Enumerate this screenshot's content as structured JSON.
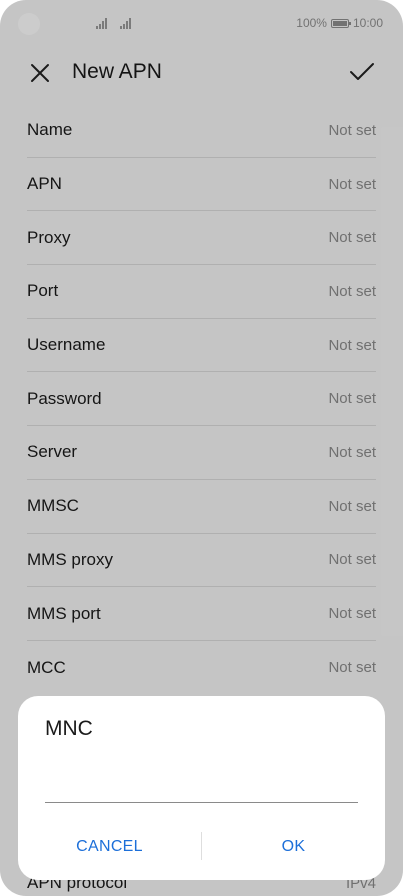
{
  "status_bar": {
    "battery_percent": "100%",
    "time": "10:00"
  },
  "header": {
    "title": "New APN",
    "close_icon": "close-icon",
    "confirm_icon": "check-icon"
  },
  "fields": [
    {
      "label": "Name",
      "value": "Not set"
    },
    {
      "label": "APN",
      "value": "Not set"
    },
    {
      "label": "Proxy",
      "value": "Not set"
    },
    {
      "label": "Port",
      "value": "Not set"
    },
    {
      "label": "Username",
      "value": "Not set"
    },
    {
      "label": "Password",
      "value": "Not set"
    },
    {
      "label": "Server",
      "value": "Not set"
    },
    {
      "label": "MMSC",
      "value": "Not set"
    },
    {
      "label": "MMS proxy",
      "value": "Not set"
    },
    {
      "label": "MMS port",
      "value": "Not set"
    },
    {
      "label": "MCC",
      "value": "Not set"
    }
  ],
  "partial_field": {
    "label": "APN protocol",
    "value": "IPv4"
  },
  "dialog": {
    "title": "MNC",
    "input_value": "",
    "cancel_label": "CANCEL",
    "ok_label": "OK"
  },
  "colors": {
    "accent": "#1c6fd9",
    "scrim": "rgba(0,0,0,0.2)"
  }
}
